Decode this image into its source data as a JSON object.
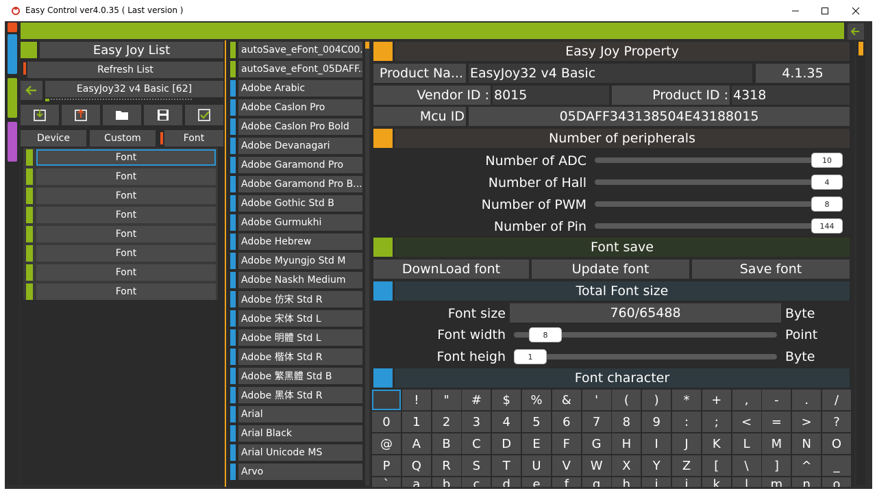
{
  "window": {
    "title": "Easy Control ver4.0.35 ( Last version )",
    "minimize": "—",
    "maximize": "☐",
    "close": "✕"
  },
  "colors": {
    "accent_green": "#8db51b",
    "accent_orange": "#f0a21b",
    "accent_blue": "#2b97d6",
    "accent_red": "#e8521f",
    "accent_purple": "#b356c7"
  },
  "left": {
    "title": "Easy Joy List",
    "refresh": "Refresh List",
    "device_name": "EasyJoy32 v4 Basic [62]",
    "back_icon": "arrow-left-icon",
    "tools": [
      "download-icon",
      "upload-icon",
      "folder-open-icon",
      "save-icon",
      "checkbox-icon"
    ],
    "tabs": [
      "Device",
      "Custom",
      "Font"
    ],
    "font_rows": [
      "Font",
      "Font",
      "Font",
      "Font",
      "Font",
      "Font",
      "Font",
      "Font"
    ]
  },
  "fonts": [
    "autoSave_eFont_004C00...",
    "autoSave_eFont_05DAFF...",
    "Adobe Arabic",
    "Adobe Caslon Pro",
    "Adobe Caslon Pro Bold",
    "Adobe Devanagari",
    "Adobe Garamond Pro",
    "Adobe Garamond Pro B...",
    "Adobe Gothic Std B",
    "Adobe Gurmukhi",
    "Adobe Hebrew",
    "Adobe Myungjo Std M",
    "Adobe Naskh Medium",
    "Adobe 仿宋 Std R",
    "Adobe 宋体 Std L",
    "Adobe 明體 Std L",
    "Adobe 楷体 Std R",
    "Adobe 繁黑體 Std B",
    "Adobe 黑体 Std R",
    "Arial",
    "Arial Black",
    "Arial Unicode MS",
    "Arvo"
  ],
  "property": {
    "title": "Easy Joy Property",
    "product_name_label": "Product Na...",
    "product_name": "EasyJoy32 v4 Basic",
    "version": "4.1.35",
    "vendor_label": "Vendor ID :",
    "vendor_id": "8015",
    "product_id_label": "Product ID :",
    "product_id": "4318",
    "mcu_label": "Mcu ID",
    "mcu_id": "05DAFF343138504E43188015"
  },
  "peripherals": {
    "title": "Number of peripherals",
    "items": [
      {
        "label": "Number of ADC",
        "value": "10",
        "fraction": 1.0
      },
      {
        "label": "Number of Hall",
        "value": "4",
        "fraction": 1.0
      },
      {
        "label": "Number of PWM",
        "value": "8",
        "fraction": 1.0
      },
      {
        "label": "Number of Pin",
        "value": "144",
        "fraction": 1.0
      }
    ]
  },
  "font_save": {
    "title": "Font save",
    "download": "DownLoad font",
    "update": "Update font",
    "save": "Save font"
  },
  "total": {
    "title": "Total Font size",
    "size_label": "Font size",
    "size_value": "760/65488",
    "size_unit": "Byte",
    "width_label": "Font width",
    "width_value": "8",
    "width_unit": "Point",
    "height_label": "Font heigh",
    "height_value": "1",
    "height_unit": "Byte"
  },
  "chars": {
    "title": "Font character",
    "rows": [
      [
        " ",
        "!",
        "\"",
        "#",
        "$",
        "%",
        "&",
        "'",
        "(",
        ")",
        "*",
        "+",
        ",",
        "-",
        ".",
        "/"
      ],
      [
        "0",
        "1",
        "2",
        "3",
        "4",
        "5",
        "6",
        "7",
        "8",
        "9",
        ":",
        ";",
        "<",
        "=",
        ">",
        "?"
      ],
      [
        "@",
        "A",
        "B",
        "C",
        "D",
        "E",
        "F",
        "G",
        "H",
        "I",
        "J",
        "K",
        "L",
        "M",
        "N",
        "O"
      ],
      [
        "P",
        "Q",
        "R",
        "S",
        "T",
        "U",
        "V",
        "W",
        "X",
        "Y",
        "Z",
        "[",
        "\\",
        "]",
        "^",
        "_"
      ],
      [
        "`",
        "a",
        "b",
        "c",
        "d",
        "e",
        "f",
        "g",
        "h",
        "i",
        "j",
        "k",
        "l",
        "m",
        "n",
        "o"
      ]
    ]
  }
}
